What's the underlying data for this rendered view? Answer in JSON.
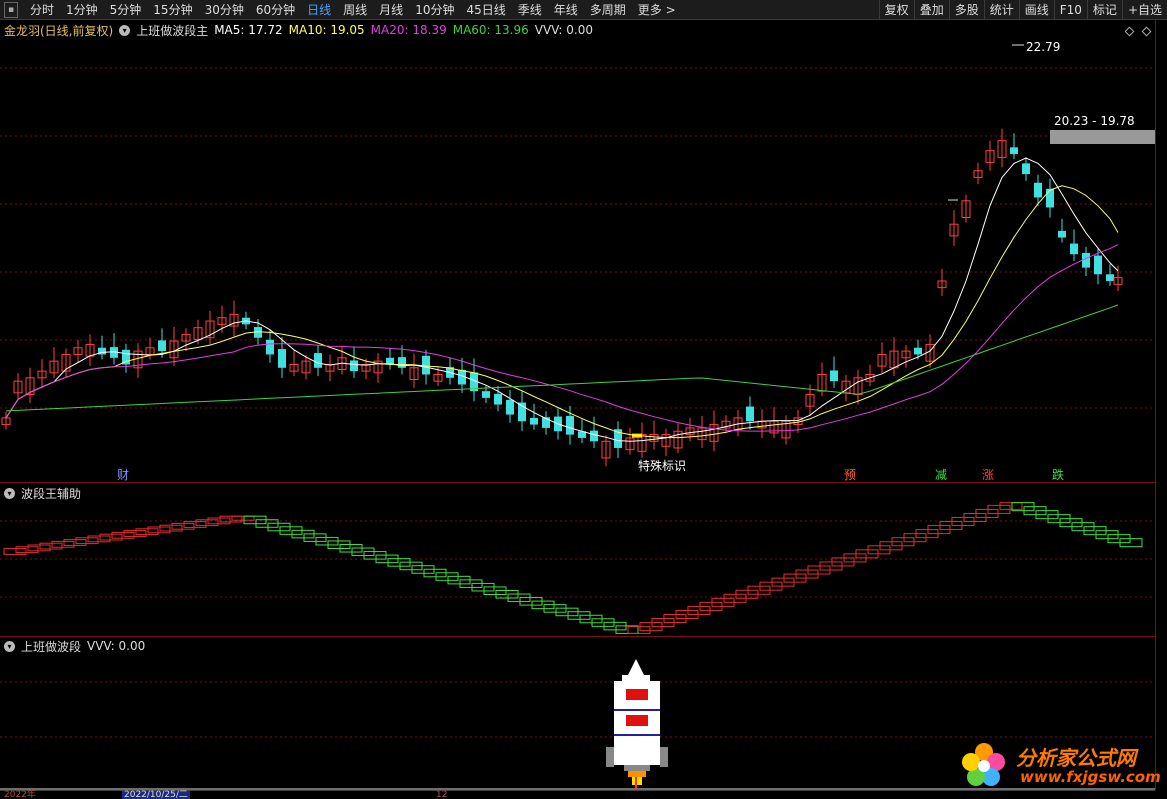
{
  "toolbar": {
    "left_items": [
      {
        "label": "分时",
        "active": false
      },
      {
        "label": "1分钟",
        "active": false
      },
      {
        "label": "5分钟",
        "active": false
      },
      {
        "label": "15分钟",
        "active": false
      },
      {
        "label": "30分钟",
        "active": false
      },
      {
        "label": "60分钟",
        "active": false
      },
      {
        "label": "日线",
        "active": true
      },
      {
        "label": "周线",
        "active": false
      },
      {
        "label": "月线",
        "active": false
      },
      {
        "label": "10分钟",
        "active": false
      },
      {
        "label": "45日线",
        "active": false
      },
      {
        "label": "季线",
        "active": false
      },
      {
        "label": "年线",
        "active": false
      },
      {
        "label": "多周期",
        "active": false
      },
      {
        "label": "更多 >",
        "active": false
      }
    ],
    "right_items": [
      "复权",
      "叠加",
      "多股",
      "统计",
      "画线",
      "F10",
      "标记",
      "+自选"
    ]
  },
  "main_legend": {
    "stock": "金龙羽(日线,前复权)",
    "indicator": "上班做波段主",
    "ma5": "MA5: 17.72",
    "ma10": "MA10: 19.05",
    "ma20": "MA20: 18.39",
    "ma60": "MA60: 13.96",
    "vvv": "VVV: 0.00"
  },
  "price_labels": {
    "high": "22.79",
    "range": "20.23 - 19.78"
  },
  "tags": {
    "cai": "财",
    "event": "特殊标识",
    "yu": "预",
    "jian": "减",
    "zhang": "涨",
    "die": "跌"
  },
  "sub1_legend": {
    "title": "波段王辅助"
  },
  "sub2_legend": {
    "title": "上班做波段",
    "vvv": "VVV: 0.00"
  },
  "watermark": {
    "cn": "分析家公式网",
    "url": "www.fxjgsw.com"
  },
  "bottom": {
    "year": "2022年",
    "date": "2022/10/25/二",
    "mark": "12"
  },
  "colors": {
    "up": "#ff4040",
    "down": "#40e0e0",
    "ma5": "#ffffff",
    "ma10": "#ffff60",
    "ma20": "#e040e0",
    "ma60": "#40d040",
    "grid": "#7a1010"
  },
  "chart_data": {
    "type": "candlestick",
    "series": [
      {
        "name": "MA5",
        "values": [
          17.72
        ]
      },
      {
        "name": "MA10",
        "values": [
          19.05
        ]
      },
      {
        "name": "MA20",
        "values": [
          18.39
        ]
      },
      {
        "name": "MA60",
        "values": [
          13.96
        ]
      }
    ],
    "annotations": [
      "22.79",
      "20.23 - 19.78"
    ]
  }
}
